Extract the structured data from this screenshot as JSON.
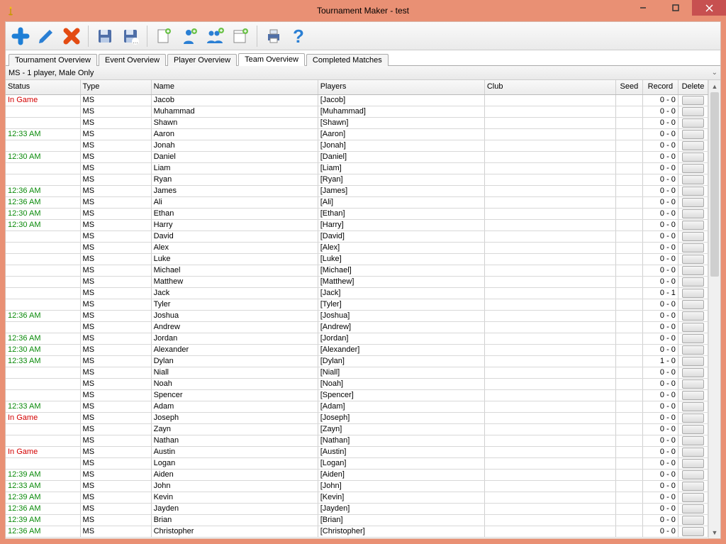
{
  "window": {
    "title": "Tournament Maker - test"
  },
  "toolbar_icons": [
    "plus",
    "tag",
    "delete",
    "save",
    "save-as",
    "new-doc",
    "add-person",
    "add-group",
    "refresh-doc",
    "print",
    "help"
  ],
  "tabs": [
    {
      "label": "Tournament Overview",
      "active": false
    },
    {
      "label": "Event Overview",
      "active": false
    },
    {
      "label": "Player Overview",
      "active": false
    },
    {
      "label": "Team Overview",
      "active": true
    },
    {
      "label": "Completed Matches",
      "active": false
    }
  ],
  "filter_text": "MS - 1 player, Male Only",
  "columns": [
    {
      "key": "status",
      "label": "Status"
    },
    {
      "key": "type",
      "label": "Type"
    },
    {
      "key": "name",
      "label": "Name"
    },
    {
      "key": "players",
      "label": "Players"
    },
    {
      "key": "club",
      "label": "Club"
    },
    {
      "key": "seed",
      "label": "Seed"
    },
    {
      "key": "record",
      "label": "Record"
    },
    {
      "key": "delete",
      "label": "Delete"
    }
  ],
  "rows": [
    {
      "status": "In Game",
      "status_class": "ingame",
      "type": "MS",
      "name": "Jacob",
      "players": "[Jacob]",
      "club": "",
      "seed": "",
      "record": "0 - 0"
    },
    {
      "status": "",
      "status_class": "",
      "type": "MS",
      "name": "Muhammad",
      "players": "[Muhammad]",
      "club": "",
      "seed": "",
      "record": "0 - 0"
    },
    {
      "status": "",
      "status_class": "",
      "type": "MS",
      "name": "Shawn",
      "players": "[Shawn]",
      "club": "",
      "seed": "",
      "record": "0 - 0"
    },
    {
      "status": "12:33 AM",
      "status_class": "time",
      "type": "MS",
      "name": "Aaron",
      "players": "[Aaron]",
      "club": "",
      "seed": "",
      "record": "0 - 0"
    },
    {
      "status": "",
      "status_class": "",
      "type": "MS",
      "name": "Jonah",
      "players": "[Jonah]",
      "club": "",
      "seed": "",
      "record": "0 - 0"
    },
    {
      "status": "12:30 AM",
      "status_class": "time",
      "type": "MS",
      "name": "Daniel",
      "players": "[Daniel]",
      "club": "",
      "seed": "",
      "record": "0 - 0"
    },
    {
      "status": "",
      "status_class": "",
      "type": "MS",
      "name": "Liam",
      "players": "[Liam]",
      "club": "",
      "seed": "",
      "record": "0 - 0"
    },
    {
      "status": "",
      "status_class": "",
      "type": "MS",
      "name": "Ryan",
      "players": "[Ryan]",
      "club": "",
      "seed": "",
      "record": "0 - 0"
    },
    {
      "status": "12:36 AM",
      "status_class": "time",
      "type": "MS",
      "name": "James",
      "players": "[James]",
      "club": "",
      "seed": "",
      "record": "0 - 0"
    },
    {
      "status": "12:36 AM",
      "status_class": "time",
      "type": "MS",
      "name": "Ali",
      "players": "[Ali]",
      "club": "",
      "seed": "",
      "record": "0 - 0"
    },
    {
      "status": "12:30 AM",
      "status_class": "time",
      "type": "MS",
      "name": "Ethan",
      "players": "[Ethan]",
      "club": "",
      "seed": "",
      "record": "0 - 0"
    },
    {
      "status": "12:30 AM",
      "status_class": "time",
      "type": "MS",
      "name": "Harry",
      "players": "[Harry]",
      "club": "",
      "seed": "",
      "record": "0 - 0"
    },
    {
      "status": "",
      "status_class": "",
      "type": "MS",
      "name": "David",
      "players": "[David]",
      "club": "",
      "seed": "",
      "record": "0 - 0"
    },
    {
      "status": "",
      "status_class": "",
      "type": "MS",
      "name": "Alex",
      "players": "[Alex]",
      "club": "",
      "seed": "",
      "record": "0 - 0"
    },
    {
      "status": "",
      "status_class": "",
      "type": "MS",
      "name": "Luke",
      "players": "[Luke]",
      "club": "",
      "seed": "",
      "record": "0 - 0"
    },
    {
      "status": "",
      "status_class": "",
      "type": "MS",
      "name": "Michael",
      "players": "[Michael]",
      "club": "",
      "seed": "",
      "record": "0 - 0"
    },
    {
      "status": "",
      "status_class": "",
      "type": "MS",
      "name": "Matthew",
      "players": "[Matthew]",
      "club": "",
      "seed": "",
      "record": "0 - 0"
    },
    {
      "status": "",
      "status_class": "",
      "type": "MS",
      "name": "Jack",
      "players": "[Jack]",
      "club": "",
      "seed": "",
      "record": "0 - 1"
    },
    {
      "status": "",
      "status_class": "",
      "type": "MS",
      "name": "Tyler",
      "players": "[Tyler]",
      "club": "",
      "seed": "",
      "record": "0 - 0"
    },
    {
      "status": "12:36 AM",
      "status_class": "time",
      "type": "MS",
      "name": "Joshua",
      "players": "[Joshua]",
      "club": "",
      "seed": "",
      "record": "0 - 0"
    },
    {
      "status": "",
      "status_class": "",
      "type": "MS",
      "name": "Andrew",
      "players": "[Andrew]",
      "club": "",
      "seed": "",
      "record": "0 - 0"
    },
    {
      "status": "12:36 AM",
      "status_class": "time",
      "type": "MS",
      "name": "Jordan",
      "players": "[Jordan]",
      "club": "",
      "seed": "",
      "record": "0 - 0"
    },
    {
      "status": "12:30 AM",
      "status_class": "time",
      "type": "MS",
      "name": "Alexander",
      "players": "[Alexander]",
      "club": "",
      "seed": "",
      "record": "0 - 0"
    },
    {
      "status": "12:33 AM",
      "status_class": "time",
      "type": "MS",
      "name": "Dylan",
      "players": "[Dylan]",
      "club": "",
      "seed": "",
      "record": "1 - 0"
    },
    {
      "status": "",
      "status_class": "",
      "type": "MS",
      "name": "Niall",
      "players": "[Niall]",
      "club": "",
      "seed": "",
      "record": "0 - 0"
    },
    {
      "status": "",
      "status_class": "",
      "type": "MS",
      "name": "Noah",
      "players": "[Noah]",
      "club": "",
      "seed": "",
      "record": "0 - 0"
    },
    {
      "status": "",
      "status_class": "",
      "type": "MS",
      "name": "Spencer",
      "players": "[Spencer]",
      "club": "",
      "seed": "",
      "record": "0 - 0"
    },
    {
      "status": "12:33 AM",
      "status_class": "time",
      "type": "MS",
      "name": "Adam",
      "players": "[Adam]",
      "club": "",
      "seed": "",
      "record": "0 - 0"
    },
    {
      "status": "In Game",
      "status_class": "ingame",
      "type": "MS",
      "name": "Joseph",
      "players": "[Joseph]",
      "club": "",
      "seed": "",
      "record": "0 - 0"
    },
    {
      "status": "",
      "status_class": "",
      "type": "MS",
      "name": "Zayn",
      "players": "[Zayn]",
      "club": "",
      "seed": "",
      "record": "0 - 0"
    },
    {
      "status": "",
      "status_class": "",
      "type": "MS",
      "name": "Nathan",
      "players": "[Nathan]",
      "club": "",
      "seed": "",
      "record": "0 - 0"
    },
    {
      "status": "In Game",
      "status_class": "ingame",
      "type": "MS",
      "name": "Austin",
      "players": "[Austin]",
      "club": "",
      "seed": "",
      "record": "0 - 0"
    },
    {
      "status": "",
      "status_class": "",
      "type": "MS",
      "name": "Logan",
      "players": "[Logan]",
      "club": "",
      "seed": "",
      "record": "0 - 0"
    },
    {
      "status": "12:39 AM",
      "status_class": "time",
      "type": "MS",
      "name": "Aiden",
      "players": "[Aiden]",
      "club": "",
      "seed": "",
      "record": "0 - 0"
    },
    {
      "status": "12:33 AM",
      "status_class": "time",
      "type": "MS",
      "name": "John",
      "players": "[John]",
      "club": "",
      "seed": "",
      "record": "0 - 0"
    },
    {
      "status": "12:39 AM",
      "status_class": "time",
      "type": "MS",
      "name": "Kevin",
      "players": "[Kevin]",
      "club": "",
      "seed": "",
      "record": "0 - 0"
    },
    {
      "status": "12:36 AM",
      "status_class": "time",
      "type": "MS",
      "name": "Jayden",
      "players": "[Jayden]",
      "club": "",
      "seed": "",
      "record": "0 - 0"
    },
    {
      "status": "12:39 AM",
      "status_class": "time",
      "type": "MS",
      "name": "Brian",
      "players": "[Brian]",
      "club": "",
      "seed": "",
      "record": "0 - 0"
    },
    {
      "status": "12:36 AM",
      "status_class": "time",
      "type": "MS",
      "name": "Christopher",
      "players": "[Christopher]",
      "club": "",
      "seed": "",
      "record": "0 - 0"
    }
  ]
}
